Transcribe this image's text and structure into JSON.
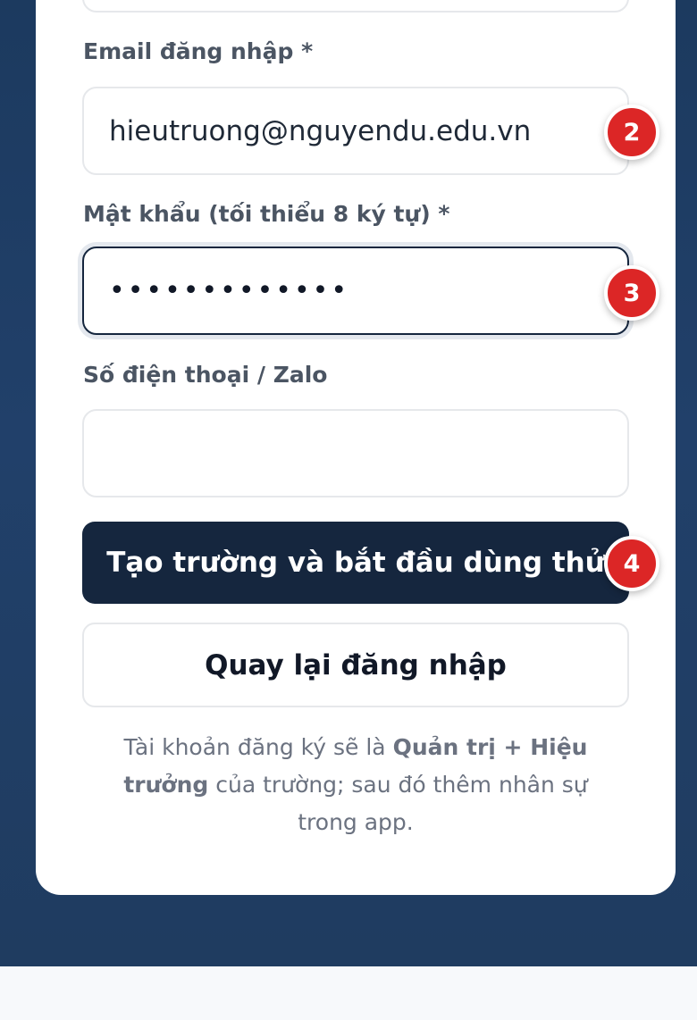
{
  "form": {
    "email_label": "Email đăng nhập *",
    "email_value": "hieutruong@nguyendu.edu.vn",
    "password_label": "Mật khẩu (tối thiểu 8 ký tự) *",
    "password_value": "•••••••••••••",
    "phone_label": "Số điện thoại / Zalo",
    "phone_value": ""
  },
  "buttons": {
    "create_label": "Tạo trường và bắt đầu dùng thử",
    "back_label": "Quay lại đăng nhập"
  },
  "note": {
    "part1": "Tài khoản đăng ký sẽ là ",
    "bold1": "Quản trị + Hiệu trưởng",
    "part2": " của trường; sau đó thêm nhân sự trong app."
  },
  "badges": [
    "2",
    "3",
    "4"
  ],
  "colors": {
    "backdrop": "#1f3c60",
    "primary": "#15263e",
    "badge": "#dc2626",
    "label": "#4b5563"
  }
}
